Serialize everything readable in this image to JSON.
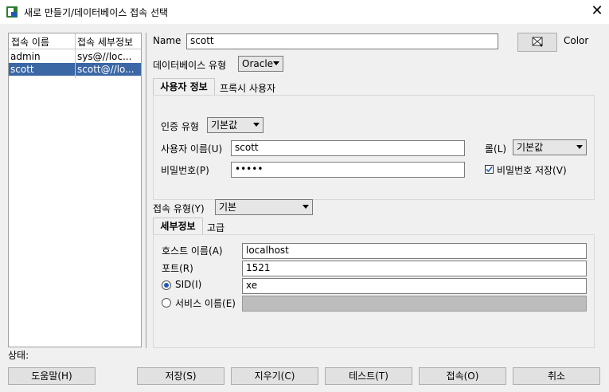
{
  "window": {
    "title": "새로 만들기/데이터베이스 접속 선택",
    "close": "✕"
  },
  "connections": {
    "headers": [
      "접속 이름",
      "접속 세부정보"
    ],
    "rows": [
      {
        "name": "admin",
        "details": "sys@//loc...",
        "selected": false
      },
      {
        "name": "scott",
        "details": "scott@//lo...",
        "selected": true
      }
    ]
  },
  "form": {
    "name_label": "Name",
    "name_value": "scott",
    "color_label": "Color",
    "db_type_label": "데이터베이스 유형",
    "db_type_value": "Oracle",
    "tabs": [
      "사용자 정보",
      "프록시 사용자"
    ],
    "auth_type_label": "인증 유형",
    "auth_type_value": "기본값",
    "username_label": "사용자 이름(U)",
    "username_value": "scott",
    "role_label": "롤(L)",
    "role_value": "기본값",
    "password_label": "비밀번호(P)",
    "password_value": "•••••",
    "save_password_label": "비밀번호 저장(V)",
    "save_password_checked": true,
    "conn_type_label": "접속 유형(Y)",
    "conn_type_value": "기본",
    "detail_tabs": [
      "세부정보",
      "고급"
    ],
    "host_label": "호스트 이름(A)",
    "host_value": "localhost",
    "port_label": "포트(R)",
    "port_value": "1521",
    "sid_label": "SID(I)",
    "sid_value": "xe",
    "service_label": "서비스 이름(E)",
    "service_value": ""
  },
  "status_label": "상태:",
  "buttons": {
    "help": "도움말(H)",
    "save": "저장(S)",
    "clear": "지우기(C)",
    "test": "테스트(T)",
    "connect": "접속(O)",
    "cancel": "취소"
  }
}
